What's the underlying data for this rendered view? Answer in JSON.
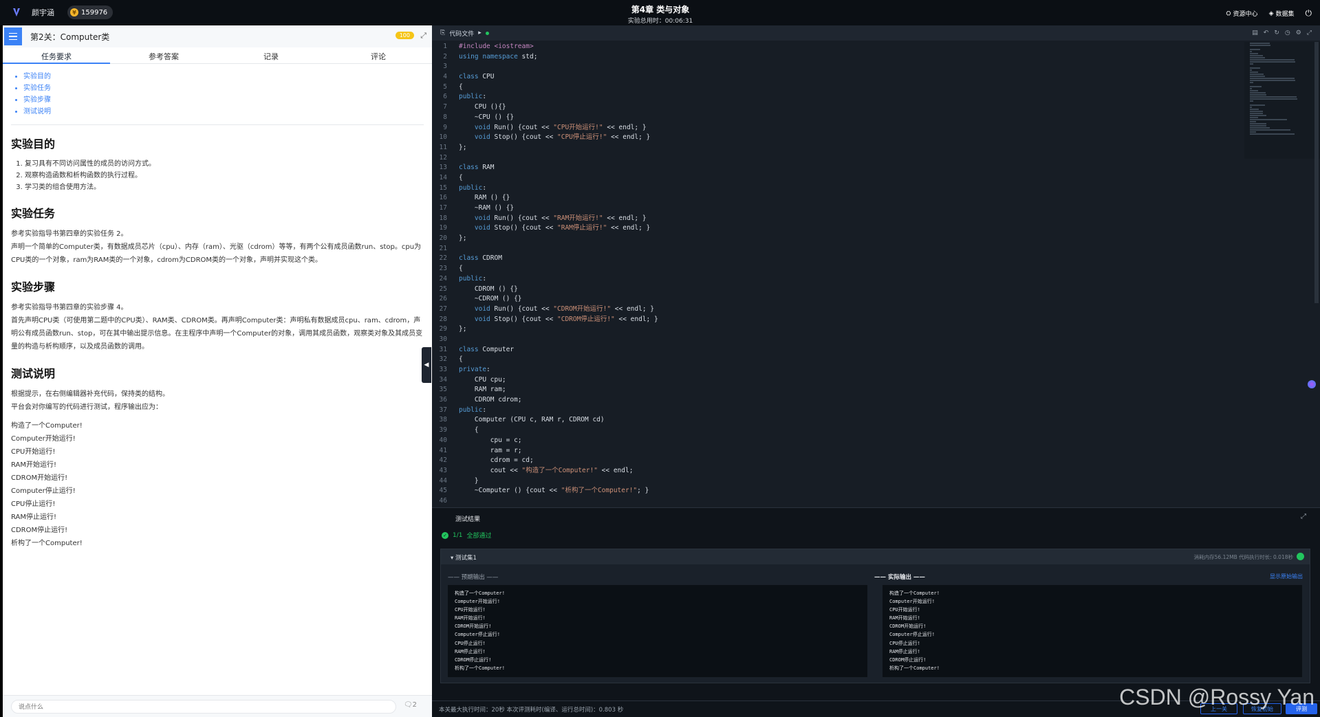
{
  "topbar": {
    "username": "颜宇涵",
    "coins": "159976",
    "chapter_title": "第4章 类与对象",
    "elapsed": "实验总用时：00:06:31",
    "resource_center": "资源中心",
    "dataset": "数据集"
  },
  "left": {
    "stage_title": "第2关：Computer类",
    "score": "100",
    "tabs": [
      "任务要求",
      "参考答案",
      "记录",
      "评论"
    ],
    "toc": [
      "实验目的",
      "实验任务",
      "实验步骤",
      "测试说明"
    ],
    "sections": {
      "purpose_title": "实验目的",
      "purpose_items": [
        "复习具有不同访问属性的成员的访问方式。",
        "观察构造函数和析构函数的执行过程。",
        "学习类的组合使用方法。"
      ],
      "task_title": "实验任务",
      "task_p1": "参考实验指导书第四章的实验任务 2。",
      "task_p2": "声明一个简单的Computer类，有数据成员芯片（cpu）、内存（ram）、光驱（cdrom）等等，有两个公有成员函数run、stop。cpu为CPU类的一个对象，ram为RAM类的一个对象，cdrom为CDROM类的一个对象，声明并实现这个类。",
      "steps_title": "实验步骤",
      "steps_p1": "参考实验指导书第四章的实验步骤 4。",
      "steps_p2": "首先声明CPU类（可使用第二题中的CPU类）、RAM类、CDROM类。再声明Computer类：声明私有数据成员cpu、ram、cdrom，声明公有成员函数run、stop，可在其中输出提示信息。在主程序中声明一个Computer的对象，调用其成员函数，观察类对象及其成员变量的构造与析构顺序，以及成员函数的调用。",
      "test_title": "测试说明",
      "test_p1": "根据提示，在右侧编辑器补充代码，保持类的结构。",
      "test_p2": "平台会对你编写的代码进行测试，程序输出应为：",
      "expected_lines": [
        "构造了一个Computer!",
        "Computer开始运行!",
        "CPU开始运行!",
        "RAM开始运行!",
        "CDROM开始运行!",
        "Computer停止运行!",
        "CPU停止运行!",
        "RAM停止运行!",
        "CDROM停止运行!",
        "析构了一个Computer!"
      ]
    },
    "comment_placeholder": "说点什么",
    "comment_count": "2"
  },
  "editor": {
    "file_tab": "代码文件",
    "lines": [
      "#include <iostream>",
      "using namespace std;",
      "",
      "class CPU",
      "{",
      "public:",
      "    CPU (){}",
      "    ~CPU () {}",
      "    void Run() {cout << \"CPU开始运行!\" << endl; }",
      "    void Stop() {cout << \"CPU停止运行!\" << endl; }",
      "};",
      "",
      "class RAM",
      "{",
      "public:",
      "    RAM () {}",
      "    ~RAM () {}",
      "    void Run() {cout << \"RAM开始运行!\" << endl; }",
      "    void Stop() {cout << \"RAM停止运行!\" << endl; }",
      "};",
      "",
      "class CDROM",
      "{",
      "public:",
      "    CDROM () {}",
      "    ~CDROM () {}",
      "    void Run() {cout << \"CDROM开始运行!\" << endl; }",
      "    void Stop() {cout << \"CDROM停止运行!\" << endl; }",
      "};",
      "",
      "class Computer",
      "{",
      "private:",
      "    CPU cpu;",
      "    RAM ram;",
      "    CDROM cdrom;",
      "public:",
      "    Computer (CPU c, RAM r, CDROM cd)",
      "    {",
      "        cpu = c;",
      "        ram = r;",
      "        cdrom = cd;",
      "        cout << \"构造了一个Computer!\" << endl;",
      "    }",
      "    ~Computer () {cout << \"析构了一个Computer!\"; }",
      ""
    ]
  },
  "results": {
    "tab": "测试结果",
    "count": "1/1",
    "status": "全部通过",
    "case_title": "测试集1",
    "case_meta": "消耗内存56.12MB    代码执行时长: 0.018秒",
    "expected_label": "—— 预期输出 ——",
    "actual_label": "—— 实际输出 ——",
    "raw_link": "显示原始输出",
    "expected_output": [
      "构造了一个Computer!",
      "Computer开始运行!",
      "CPU开始运行!",
      "RAM开始运行!",
      "CDROM开始运行!",
      "Computer停止运行!",
      "CPU停止运行!",
      "RAM停止运行!",
      "CDROM停止运行!",
      "析构了一个Computer!"
    ],
    "actual_output": [
      "构造了一个Computer!",
      "Computer开始运行!",
      "CPU开始运行!",
      "RAM开始运行!",
      "CDROM开始运行!",
      "Computer停止运行!",
      "CPU停止运行!",
      "RAM停止运行!",
      "CDROM停止运行!",
      "析构了一个Computer!"
    ],
    "footer": "本关最大执行时间：20秒    本次评测耗时(编译、运行总时间)：0.803 秒",
    "btn_prev": "上一关",
    "btn_restore": "恢复初始",
    "btn_eval": "评测"
  },
  "watermark": "CSDN @Rossy Yan",
  "colors": {
    "accent": "#3b82f6",
    "success": "#22c55e",
    "editor_bg": "#171d25"
  }
}
